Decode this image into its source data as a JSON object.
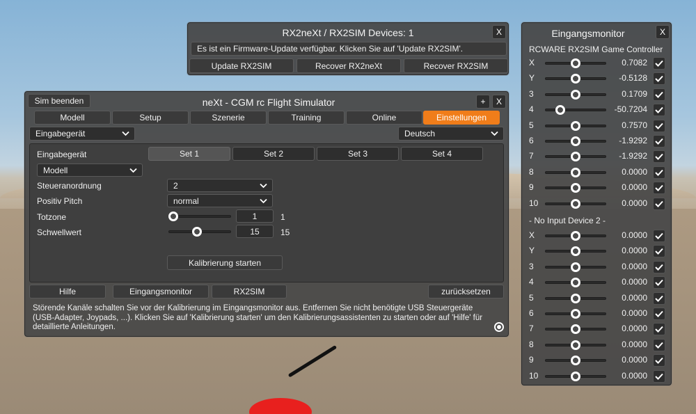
{
  "rx2sim_window": {
    "title": "RX2neXt / RX2SIM  Devices: 1",
    "close_label": "X",
    "message": "Es ist ein Firmware-Update verfügbar. Klicken Sie auf 'Update RX2SIM'.",
    "buttons": [
      "Update RX2SIM",
      "Recover RX2neXt",
      "Recover RX2SIM"
    ]
  },
  "main_window": {
    "title": "neXt  -  CGM rc Flight Simulator",
    "quit_label": "Sim beenden",
    "plus_label": "+",
    "close_label": "X",
    "tabs": [
      {
        "label": "Modell",
        "active": false
      },
      {
        "label": "Setup",
        "active": false
      },
      {
        "label": "Szenerie",
        "active": false
      },
      {
        "label": "Training",
        "active": false
      },
      {
        "label": "Online",
        "active": false
      },
      {
        "label": "Einstellungen",
        "active": true
      }
    ],
    "category_select": "Eingabegerät",
    "language_select": "Deutsch",
    "device_label": "Eingabegerät",
    "sets": [
      {
        "label": "Set 1",
        "active": true
      },
      {
        "label": "Set 2",
        "active": false
      },
      {
        "label": "Set 3",
        "active": false
      },
      {
        "label": "Set 4",
        "active": false
      }
    ],
    "model_select": "Modell",
    "rows": {
      "steueranordnung": {
        "label": "Steueranordnung",
        "value": "2"
      },
      "positiv_pitch": {
        "label": "Positiv Pitch",
        "value": "normal"
      },
      "totzone": {
        "label": "Totzone",
        "input": "1",
        "display": "1",
        "level": 0.0
      },
      "schwellwert": {
        "label": "Schwellwert",
        "input": "15",
        "display": "15",
        "level": 0.45
      }
    },
    "calibrate_label": "Kalibrierung starten",
    "bottom_buttons": {
      "help": "Hilfe",
      "monitor": "Eingangsmonitor",
      "rx2sim": "RX2SIM",
      "reset": "zurücksetzen"
    },
    "info_text_lines": [
      "Störende Kanäle schalten Sie vor der Kalibrierung im Eingangsmonitor aus. Entfernen Sie nicht benötigte USB Steuergeräte",
      "(USB-Adapter, Joypads, ...). Klicken Sie auf 'Kalibrierung starten' um den Kalibrierungsassistenten zu starten oder auf 'Hilfe' für",
      "detaillierte Anleitungen."
    ]
  },
  "monitor_window": {
    "title": "Eingangsmonitor",
    "close_label": "X",
    "device1_name": "RCWARE RX2SIM Game Controller",
    "device1_channels": [
      {
        "ch": "X",
        "value": "0.7082",
        "level": 0.5
      },
      {
        "ch": "Y",
        "value": "-0.5128",
        "level": 0.5
      },
      {
        "ch": "3",
        "value": "0.1709",
        "level": 0.5
      },
      {
        "ch": "4",
        "value": "-50.7204",
        "level": 0.25
      },
      {
        "ch": "5",
        "value": "0.7570",
        "level": 0.5
      },
      {
        "ch": "6",
        "value": "-1.9292",
        "level": 0.5
      },
      {
        "ch": "7",
        "value": "-1.9292",
        "level": 0.5
      },
      {
        "ch": "8",
        "value": "0.0000",
        "level": 0.5
      },
      {
        "ch": "9",
        "value": "0.0000",
        "level": 0.5
      },
      {
        "ch": "10",
        "value": "0.0000",
        "level": 0.5
      }
    ],
    "device2_name": "- No Input Device 2 -",
    "device2_channels": [
      {
        "ch": "X",
        "value": "0.0000",
        "level": 0.5
      },
      {
        "ch": "Y",
        "value": "0.0000",
        "level": 0.5
      },
      {
        "ch": "3",
        "value": "0.0000",
        "level": 0.5
      },
      {
        "ch": "4",
        "value": "0.0000",
        "level": 0.5
      },
      {
        "ch": "5",
        "value": "0.0000",
        "level": 0.5
      },
      {
        "ch": "6",
        "value": "0.0000",
        "level": 0.5
      },
      {
        "ch": "7",
        "value": "0.0000",
        "level": 0.5
      },
      {
        "ch": "8",
        "value": "0.0000",
        "level": 0.5
      },
      {
        "ch": "9",
        "value": "0.0000",
        "level": 0.5
      },
      {
        "ch": "10",
        "value": "0.0000",
        "level": 0.5
      }
    ]
  },
  "colors": {
    "accent": "#f07d1a",
    "panel": "#484848",
    "control": "#2e2e2e"
  }
}
